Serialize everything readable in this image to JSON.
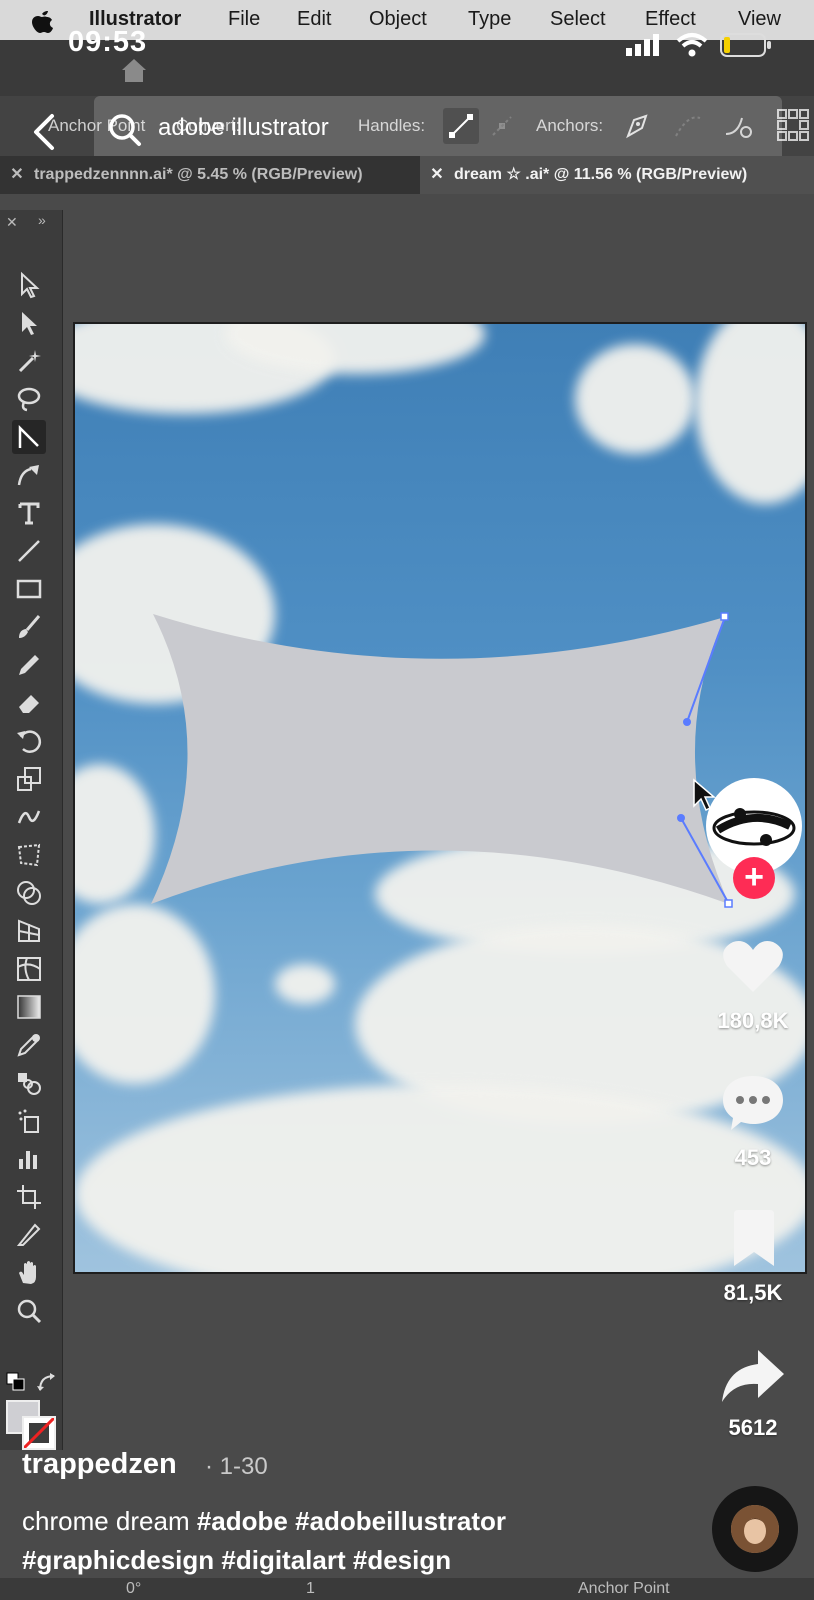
{
  "menubar": {
    "app": "Illustrator",
    "items": [
      "File",
      "Edit",
      "Object",
      "Type",
      "Select",
      "Effect",
      "View"
    ]
  },
  "status": {
    "time": "09:53"
  },
  "search": {
    "query": "adobe illustrator"
  },
  "controlbar": {
    "tool_label": "Anchor Point",
    "convert_label": "Convert:",
    "handles_label": "Handles:",
    "anchors_label": "Anchors:"
  },
  "tabs": [
    {
      "label": "trappedzennnn.ai* @ 5.45 % (RGB/Preview)",
      "active": false
    },
    {
      "label": "dream ☆ .ai* @ 11.56 % (RGB/Preview)",
      "active": true
    }
  ],
  "rail": {
    "likes": "180,8K",
    "comments": "453",
    "saves": "81,5K",
    "shares": "5612"
  },
  "post": {
    "username": "trappedzen",
    "date": "· 1-30",
    "caption_text": "chrome dream ",
    "hashtags_line1": [
      "#adobe",
      "#adobeillustrator"
    ],
    "hashtags_line2": [
      "#graphicdesign",
      "#digitalart",
      "#design"
    ]
  },
  "bottombar": {
    "rotation": "0°",
    "artboard_num": "1",
    "tool_status": "Anchor Point"
  }
}
